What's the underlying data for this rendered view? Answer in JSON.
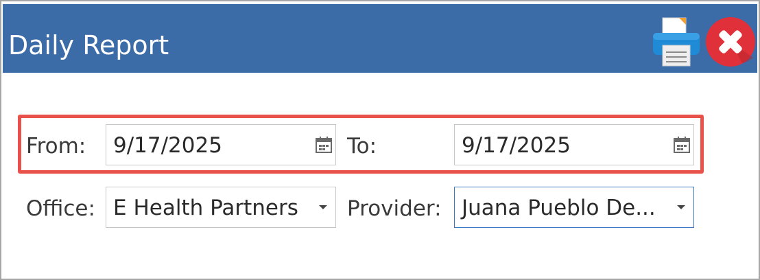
{
  "window": {
    "title": "Daily Report"
  },
  "toolbar": {
    "print_icon": "printer-icon",
    "close_icon": "close-icon"
  },
  "colors": {
    "titlebar": "#3b6ca8",
    "highlight": "#e8524a",
    "close": "#e0303a"
  },
  "dates": {
    "from_label": "From:",
    "from_value": "9/17/2025",
    "to_label": "To:",
    "to_value": "9/17/2025"
  },
  "filters": {
    "office_label": "Office:",
    "office_value": "E Health Partners",
    "provider_label": "Provider:",
    "provider_value": "Juana Pueblo De..."
  }
}
